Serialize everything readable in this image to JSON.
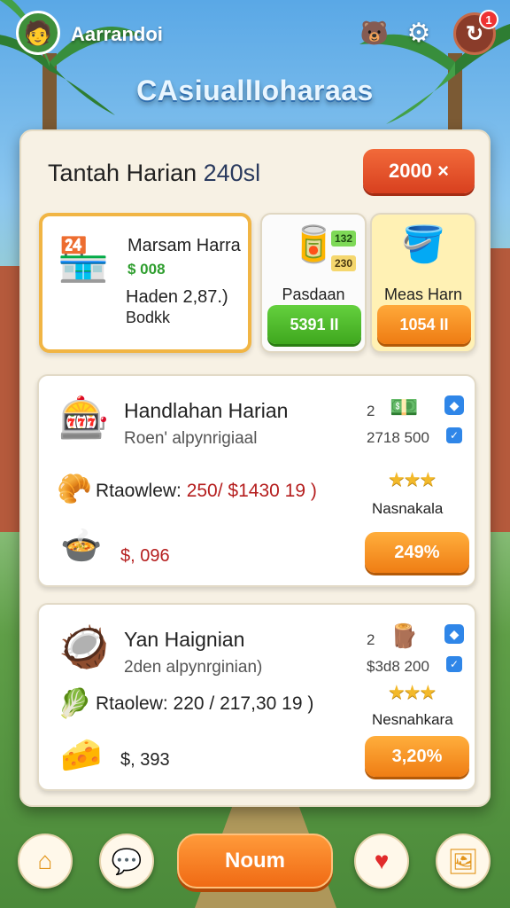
{
  "header": {
    "player_name": "Aarrandoi",
    "avatar_icon": "player-avatar",
    "mascot_icon": "mascot-icon",
    "settings_icon": "gear-icon",
    "notification_icon": "refresh-icon",
    "notification_count": "1"
  },
  "game_title": "CAsiuallIoharaas",
  "panel": {
    "title": "Tantah Harian",
    "title_number": "240sl",
    "top_button": "2000 ×"
  },
  "featured": {
    "title": "Marsam Harra",
    "value": "$ 008",
    "line1": "Haden  2,87.)",
    "line2": "Bodkk"
  },
  "shop_cards": [
    {
      "label": "Pasdaan",
      "button": "5391 II",
      "tag1": "132",
      "tag2": "230"
    },
    {
      "label": "Meas Harn",
      "button": "1054 II"
    }
  ],
  "quests": [
    {
      "title": "Handlahan Harian",
      "subtitle": "Roen' alpynrigiaal",
      "count": "2",
      "amount": "2718 500",
      "reward": "Rtaowlew: ",
      "reward_value": "250/ $1430 19 )",
      "stars": "★★★",
      "label": "Nasnakala",
      "price": "$, 096",
      "button": "249%"
    },
    {
      "title": "Yan Haignian",
      "subtitle": "2den alpynrginian)",
      "count": "2",
      "amount": "$3d8 200",
      "reward": "Rtaolew: 220 / 217,30 19 )",
      "stars": "★★★",
      "label": "Nesnahkara",
      "price": "$, 393",
      "button": "3,20%"
    }
  ],
  "bottom_nav": {
    "main_button": "Noum"
  },
  "colors": {
    "accent_orange": "#f07a14",
    "accent_red": "#d8401f",
    "accent_green": "#3fa71e",
    "panel_bg": "#f7f1e4"
  }
}
